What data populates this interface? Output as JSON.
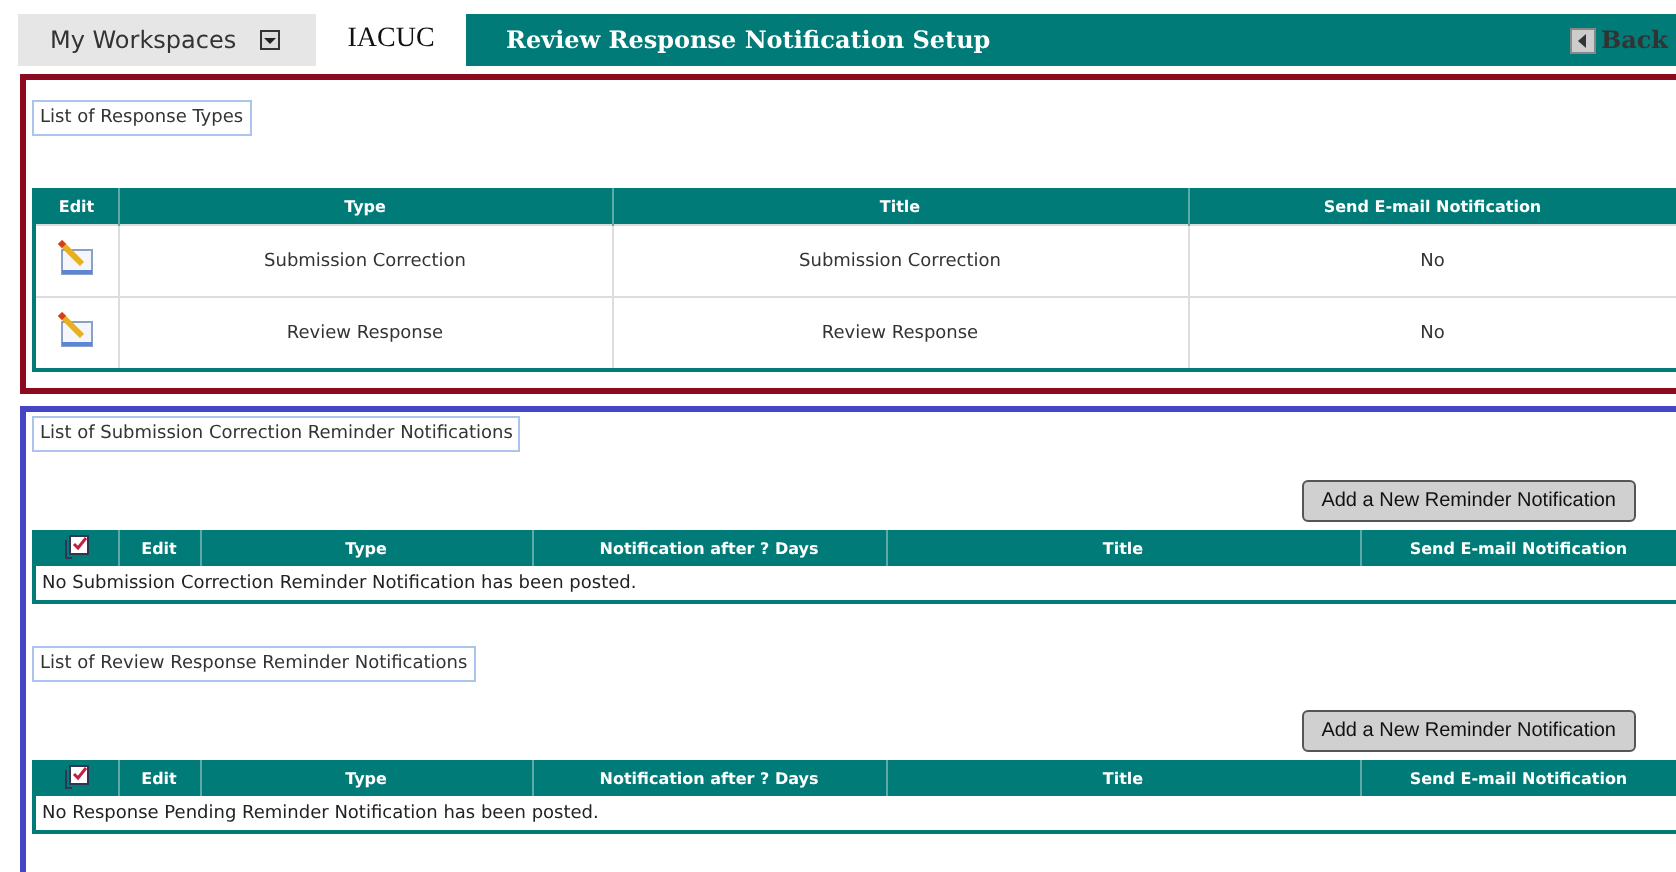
{
  "top_bar": {
    "workspaces": "My Workspaces",
    "app_tab": "IACUC",
    "page_title": "Review Response Notification Setup",
    "back": "Back"
  },
  "response_types": {
    "legend": "List of Response Types",
    "columns": [
      "Edit",
      "Type",
      "Title",
      "Send E-mail Notification"
    ],
    "rows": [
      {
        "type": "Submission Correction",
        "title": "Submission Correction",
        "send_email": "No"
      },
      {
        "type": "Review Response",
        "title": "Review Response",
        "send_email": "No"
      }
    ]
  },
  "reminder_lists": [
    {
      "legend": "List of Submission Correction Reminder Notifications",
      "button": "Add a New Reminder Notification",
      "columns": [
        "Edit",
        "Type",
        "Notification after ? Days",
        "Title",
        "Send E-mail Notification"
      ],
      "empty_message": "No Submission Correction Reminder Notification has been posted."
    },
    {
      "legend": "List of Review Response Reminder Notifications",
      "button": "Add a New Reminder Notification",
      "columns": [
        "Edit",
        "Type",
        "Notification after ? Days",
        "Title",
        "Send E-mail Notification"
      ],
      "empty_message": "No Response Pending Reminder Notification has been posted."
    }
  ]
}
